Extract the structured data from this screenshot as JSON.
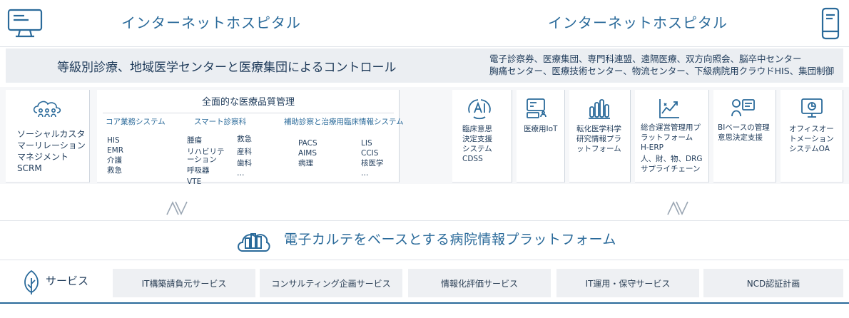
{
  "header": {
    "left_title": "インターネットホスピタル",
    "right_title": "インターネットホスピタル",
    "left_icon": "desktop-monitor-icon",
    "right_icon": "smartphone-icon"
  },
  "band": {
    "left_text": "等級別診療、地域医学センターと医療集団によるコントロール",
    "right_line1": "電子診察券、医療集団、専門科連盟、遠隔医療、双方向照会、脳卒中センター",
    "right_line2": "胸痛センター、医療技術センター、物流センター、下級病院用クラウドHIS、集団制御"
  },
  "scrm": {
    "icon": "people-cloud-icon",
    "lines": [
      "ソーシャルカスタ",
      "マーリレーション",
      "マネジメントSCRM"
    ]
  },
  "quality": {
    "title": "全面的な医療品質管理",
    "core": {
      "title": "コア業務システム",
      "items": [
        "HIS",
        "EMR",
        "介護",
        "救急"
      ]
    },
    "smart": {
      "title": "スマート診察科",
      "col1": [
        "腫瘍",
        "リハビリテ",
        "ーション",
        "呼吸器",
        "VTE"
      ],
      "col2": [
        "救急",
        "産科",
        "歯科",
        "…"
      ]
    },
    "aux": {
      "title": "補助診察と治療用臨床情報システム",
      "col1": [
        "PACS",
        "AIMS",
        "病理"
      ],
      "col2": [
        "LIS",
        "CCIS",
        "核医学",
        "…"
      ]
    }
  },
  "modules": [
    {
      "icon": "ai-icon",
      "lines": [
        "臨床意思",
        "決定支援",
        "システム",
        "CDSS"
      ]
    },
    {
      "icon": "iot-device-icon",
      "lines": [
        "医療用IoT"
      ]
    },
    {
      "icon": "research-bars-icon",
      "lines": [
        "転化医学科学",
        "研究情報プラ",
        "ットフォーム"
      ]
    },
    {
      "icon": "trend-chart-icon",
      "lines": [
        "総合運営管理用プ",
        "ラットフォーム",
        "H-ERP",
        "人、財、物、DRG",
        "サプライチェーン"
      ]
    },
    {
      "icon": "person-board-icon",
      "lines": [
        "BIベースの管理",
        "意思決定支援"
      ]
    },
    {
      "icon": "office-monitor-icon",
      "lines": [
        "オフィスオー",
        "トメーション",
        "システムOA"
      ]
    }
  ],
  "platform": {
    "icon": "hospital-cloud-icon",
    "title": "電子カルテをベースとする病院情報プラットフォーム"
  },
  "services": {
    "label": "サービス",
    "icon": "leaf-icon",
    "items": [
      "IT構築請負元サービス",
      "コンサルティング企画サービス",
      "情報化評価サービス",
      "IT運用・保守サービス",
      "NCD認証計画"
    ]
  },
  "colors": {
    "accent": "#2a6a9a",
    "band_bg": "#ebeef2",
    "service_bg": "#eef0f3"
  }
}
